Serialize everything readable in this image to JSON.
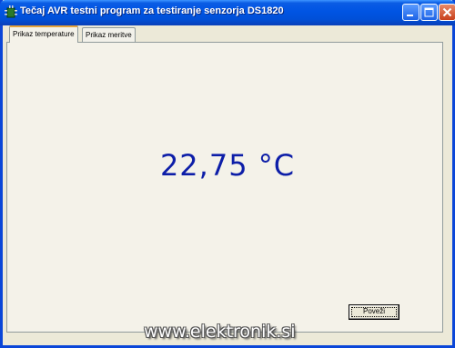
{
  "window": {
    "title": "Tečaj AVR testni program za testiranje senzorja DS1820",
    "icon": "app-icon"
  },
  "tabs": [
    {
      "label": "Prikaz temperature",
      "active": true
    },
    {
      "label": "Prikaz meritve",
      "active": false
    }
  ],
  "main": {
    "temperature_display": "22,75 °C"
  },
  "buttons": {
    "connect_label": "Poveži"
  },
  "watermark": "www.elektronik.si",
  "colors": {
    "titlebar": "#0054e3",
    "temperature_text": "#0d1ea8",
    "window_bg": "#ece9d8"
  }
}
